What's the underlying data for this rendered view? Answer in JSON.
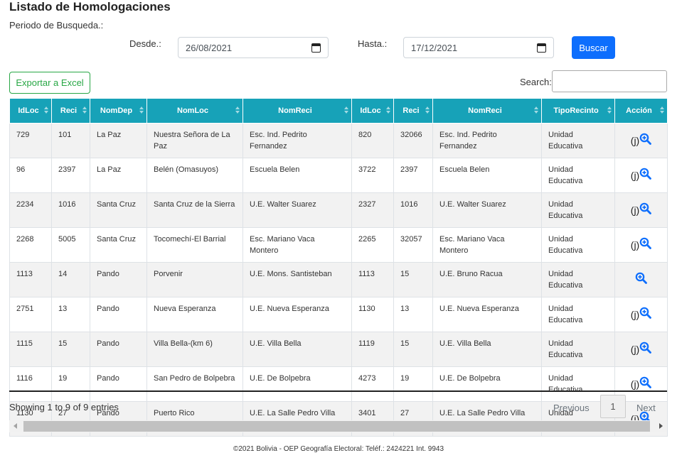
{
  "page": {
    "title": "Listado de Homologaciones",
    "period_label": "Periodo de Busqueda.:"
  },
  "filters": {
    "desde_label": "Desde.:",
    "desde_value": "26/08/2021",
    "hasta_label": "Hasta.:",
    "hasta_value": "17/12/2021",
    "buscar_label": "Buscar"
  },
  "toolbar": {
    "export_label": "Exportar a Excel",
    "search_label": "Search:",
    "search_value": ""
  },
  "table": {
    "columns": [
      "IdLoc",
      "Reci",
      "NomDep",
      "NomLoc",
      "NomReci",
      "IdLoc",
      "Reci",
      "NomReci",
      "TipoRecinto",
      "Acción"
    ],
    "rows": [
      [
        "729",
        "101",
        "La Paz",
        "Nuestra Señora de La Paz",
        "Esc. Ind. Pedrito Fernandez",
        "820",
        "32066",
        "Esc. Ind. Pedrito Fernandez",
        "Unidad Educativa",
        "(j)"
      ],
      [
        "96",
        "2397",
        "La Paz",
        "Belén (Omasuyos)",
        "Escuela Belen",
        "3722",
        "2397",
        "Escuela Belen",
        "Unidad Educativa",
        "(j)"
      ],
      [
        "2234",
        "1016",
        "Santa Cruz",
        "Santa Cruz de la Sierra",
        "U.E. Walter Suarez",
        "2327",
        "1016",
        "U.E. Walter Suarez",
        "Unidad Educativa",
        "(j)"
      ],
      [
        "2268",
        "5005",
        "Santa Cruz",
        "Tocomechí-El Barrial",
        "Esc. Mariano Vaca Montero",
        "2265",
        "32057",
        "Esc. Mariano Vaca Montero",
        "Unidad Educativa",
        "(j)"
      ],
      [
        "1113",
        "14",
        "Pando",
        "Porvenir",
        "U.E. Mons. Santisteban",
        "1113",
        "15",
        "U.E. Bruno Racua",
        "Unidad Educativa",
        ""
      ],
      [
        "2751",
        "13",
        "Pando",
        "Nueva Esperanza",
        "U.E. Nueva Esperanza",
        "1130",
        "13",
        "U.E. Nueva Esperanza",
        "Unidad Educativa",
        "(j)"
      ],
      [
        "1115",
        "15",
        "Pando",
        "Villa Bella-(km 6)",
        "U.E. Villa Bella",
        "1119",
        "15",
        "U.E. Villa Bella",
        "Unidad Educativa",
        "(j)"
      ],
      [
        "1116",
        "19",
        "Pando",
        "San Pedro de Bolpebra",
        "U.E. De Bolpebra",
        "4273",
        "19",
        "U.E. De Bolpebra",
        "Unidad Educativa",
        "(j)"
      ],
      [
        "1130",
        "27",
        "Pando",
        "Puerto Rico",
        "U.E. La Salle Pedro Villa Lobos",
        "3401",
        "27",
        "U.E. La Salle Pedro Villa Lobos",
        "Unidad Educativa",
        "(j)"
      ]
    ]
  },
  "pagination": {
    "info": "Showing 1 to 9 of 9 entries",
    "previous": "Previous",
    "current": "1",
    "next": "Next"
  },
  "footer": "©2021 Bolivia - OEP Geografía Electoral: Teléf.: 2424221 Int. 9943",
  "colors": {
    "header_bg": "#17a2b8",
    "primary": "#0d6efd",
    "excel": "#28a745",
    "zoom_icon": "#0d6efd"
  },
  "icons": {
    "zoom": "zoom-in-icon",
    "calendar": "calendar-icon",
    "sort": "sort-icon"
  }
}
